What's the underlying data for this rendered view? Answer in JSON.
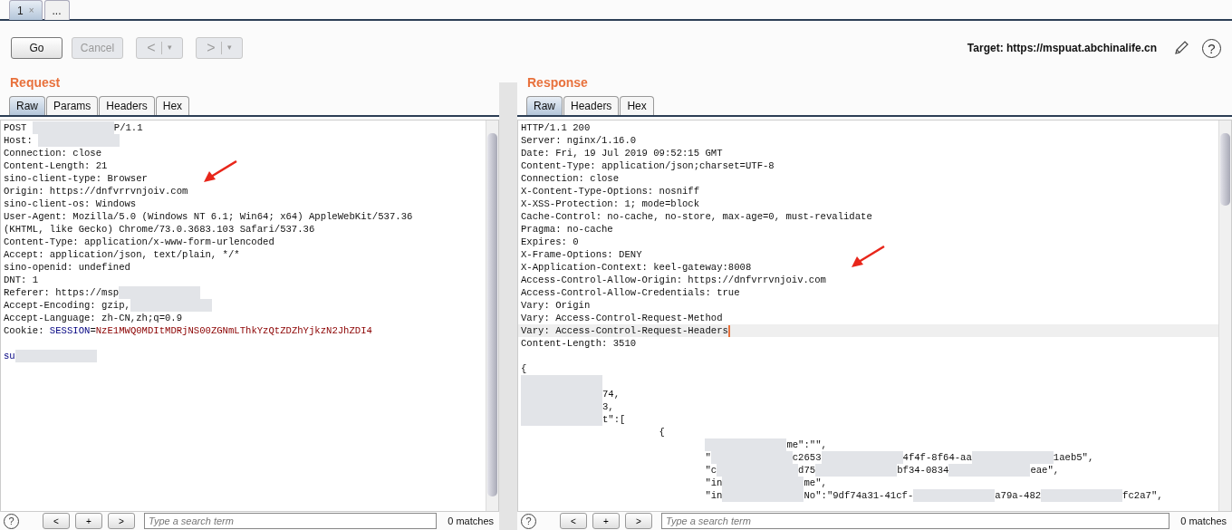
{
  "tabs": [
    {
      "label": "1",
      "close": "×",
      "selected": true
    },
    {
      "label": "...",
      "selected": false
    }
  ],
  "toolbar": {
    "buttons": [
      {
        "kind": "plain",
        "label": "Go",
        "disabled": false
      },
      {
        "kind": "plain",
        "label": "Cancel",
        "disabled": true
      },
      {
        "kind": "nav",
        "label": "<",
        "caret": "▾",
        "disabled": true
      },
      {
        "kind": "nav",
        "label": ">",
        "caret": "▾",
        "disabled": true
      }
    ],
    "target": "Target: https://mspuat.abchinalife.cn",
    "help": "?"
  },
  "panels": [
    {
      "title": "Request",
      "tabs": [
        {
          "label": "Raw",
          "selected": true
        },
        {
          "label": "Params",
          "selected": false
        },
        {
          "label": "Headers",
          "selected": false
        },
        {
          "label": "Hex",
          "selected": false
        }
      ],
      "lines": [
        {
          "segments": [
            {
              "kind": "text",
              "text": "POST "
            },
            {
              "kind": "redacted"
            },
            {
              "kind": "text",
              "text": "P/1.1"
            }
          ]
        },
        {
          "segments": [
            {
              "kind": "text",
              "text": "Host: "
            },
            {
              "kind": "redacted"
            }
          ]
        },
        {
          "segments": [
            {
              "kind": "text",
              "text": "Connection: close"
            }
          ]
        },
        {
          "segments": [
            {
              "kind": "text",
              "text": "Content-Length: 21"
            }
          ]
        },
        {
          "segments": [
            {
              "kind": "text",
              "text": "sino-client-type: Browser"
            }
          ]
        },
        {
          "segments": [
            {
              "kind": "text",
              "text": "Origin: https://dnfvrrvnjoiv.com"
            }
          ]
        },
        {
          "segments": [
            {
              "kind": "text",
              "text": "sino-client-os: Windows"
            }
          ]
        },
        {
          "segments": [
            {
              "kind": "text",
              "text": "User-Agent: Mozilla/5.0 (Windows NT 6.1; Win64; x64) AppleWebKit/537.36"
            }
          ]
        },
        {
          "segments": [
            {
              "kind": "text",
              "text": "(KHTML, like Gecko) Chrome/73.0.3683.103 Safari/537.36"
            }
          ]
        },
        {
          "segments": [
            {
              "kind": "text",
              "text": "Content-Type: application/x-www-form-urlencoded"
            }
          ]
        },
        {
          "segments": [
            {
              "kind": "text",
              "text": "Accept: application/json, text/plain, */*"
            }
          ]
        },
        {
          "segments": [
            {
              "kind": "text",
              "text": "sino-openid: undefined"
            }
          ]
        },
        {
          "segments": [
            {
              "kind": "text",
              "text": "DNT: 1"
            }
          ]
        },
        {
          "segments": [
            {
              "kind": "text",
              "text": "Referer: https://msp"
            },
            {
              "kind": "redacted"
            }
          ]
        },
        {
          "segments": [
            {
              "kind": "text",
              "text": "Accept-Encoding: gzip,"
            },
            {
              "kind": "redacted"
            }
          ]
        },
        {
          "segments": [
            {
              "kind": "text",
              "text": "Accept-Language: zh-CN,zh;q=0.9"
            }
          ]
        },
        {
          "segments": [
            {
              "kind": "text",
              "text": "Cookie: "
            },
            {
              "kind": "name",
              "text": "SESSION"
            },
            {
              "kind": "text",
              "text": "="
            },
            {
              "kind": "value",
              "text": "NzE1MWQ0MDItMDRjNS00ZGNmLThkYzQtZDZhYjkzN2JhZDI4"
            }
          ]
        },
        {
          "gap_before": true,
          "segments": [
            {
              "kind": "name",
              "text": "su"
            },
            {
              "kind": "redacted"
            }
          ]
        }
      ],
      "annotation_arrow": true,
      "search": {
        "help": "?",
        "placeholder": "Type a search term",
        "buttons": [
          "<",
          "+",
          ">"
        ],
        "matches": "0 matches"
      }
    },
    {
      "title": "Response",
      "tabs": [
        {
          "label": "Raw",
          "selected": true
        },
        {
          "label": "Headers",
          "selected": false
        },
        {
          "label": "Hex",
          "selected": false
        }
      ],
      "lines": [
        {
          "segments": [
            {
              "kind": "text",
              "text": "HTTP/1.1 200"
            }
          ]
        },
        {
          "segments": [
            {
              "kind": "text",
              "text": "Server: nginx/1.16.0"
            }
          ]
        },
        {
          "segments": [
            {
              "kind": "text",
              "text": "Date: Fri, 19 Jul 2019 09:52:15 GMT"
            }
          ]
        },
        {
          "segments": [
            {
              "kind": "text",
              "text": "Content-Type: application/json;charset=UTF-8"
            }
          ]
        },
        {
          "segments": [
            {
              "kind": "text",
              "text": "Connection: close"
            }
          ]
        },
        {
          "segments": [
            {
              "kind": "text",
              "text": "X-Content-Type-Options: nosniff"
            }
          ]
        },
        {
          "segments": [
            {
              "kind": "text",
              "text": "X-XSS-Protection: 1; mode=block"
            }
          ]
        },
        {
          "segments": [
            {
              "kind": "text",
              "text": "Cache-Control: no-cache, no-store, max-age=0, must-revalidate"
            }
          ]
        },
        {
          "segments": [
            {
              "kind": "text",
              "text": "Pragma: no-cache"
            }
          ]
        },
        {
          "segments": [
            {
              "kind": "text",
              "text": "Expires: 0"
            }
          ]
        },
        {
          "segments": [
            {
              "kind": "text",
              "text": "X-Frame-Options: DENY"
            }
          ]
        },
        {
          "segments": [
            {
              "kind": "text",
              "text": "X-Application-Context: keel-gateway:8008"
            }
          ]
        },
        {
          "segments": [
            {
              "kind": "text",
              "text": "Access-Control-Allow-Origin: https://dnfvrrvnjoiv.com"
            }
          ]
        },
        {
          "segments": [
            {
              "kind": "text",
              "text": "Access-Control-Allow-Credentials: true"
            }
          ]
        },
        {
          "segments": [
            {
              "kind": "text",
              "text": "Vary: Origin"
            }
          ]
        },
        {
          "segments": [
            {
              "kind": "text",
              "text": "Vary: Access-Control-Request-Method"
            }
          ]
        },
        {
          "segments": [
            {
              "kind": "text",
              "text": "Vary: Access-Control-Request-Headers"
            }
          ],
          "highlighted": true
        },
        {
          "segments": [
            {
              "kind": "text",
              "text": "Content-Length: 3510"
            }
          ]
        },
        {
          "gap_before": true,
          "segments": [
            {
              "kind": "text",
              "text": "{"
            }
          ]
        },
        {
          "segments": [
            {
              "kind": "redacted"
            }
          ]
        },
        {
          "segments": [
            {
              "kind": "redacted"
            },
            {
              "kind": "text",
              "text": "74,"
            }
          ]
        },
        {
          "segments": [
            {
              "kind": "redacted"
            },
            {
              "kind": "text",
              "text": "3,"
            }
          ]
        },
        {
          "segments": [
            {
              "kind": "redacted"
            },
            {
              "kind": "text",
              "text": "t\":["
            }
          ]
        },
        {
          "segments": [
            {
              "kind": "indent"
            },
            {
              "kind": "indent"
            },
            {
              "kind": "indent"
            },
            {
              "kind": "text",
              "text": "{"
            }
          ]
        },
        {
          "segments": [
            {
              "kind": "indent"
            },
            {
              "kind": "indent"
            },
            {
              "kind": "indent"
            },
            {
              "kind": "indent"
            },
            {
              "kind": "redacted"
            },
            {
              "kind": "text",
              "text": "me\":\"\","
            }
          ]
        },
        {
          "segments": [
            {
              "kind": "indent"
            },
            {
              "kind": "indent"
            },
            {
              "kind": "indent"
            },
            {
              "kind": "indent"
            },
            {
              "kind": "text",
              "text": "\""
            },
            {
              "kind": "redacted"
            },
            {
              "kind": "text",
              "text": "c2653"
            },
            {
              "kind": "redacted"
            },
            {
              "kind": "text",
              "text": "4f4f-8f64-aa"
            },
            {
              "kind": "redacted"
            },
            {
              "kind": "text",
              "text": "1aeb5\","
            }
          ]
        },
        {
          "segments": [
            {
              "kind": "indent"
            },
            {
              "kind": "indent"
            },
            {
              "kind": "indent"
            },
            {
              "kind": "indent"
            },
            {
              "kind": "text",
              "text": "\"c"
            },
            {
              "kind": "redacted"
            },
            {
              "kind": "text",
              "text": "d75"
            },
            {
              "kind": "redacted"
            },
            {
              "kind": "text",
              "text": "bf34-0834"
            },
            {
              "kind": "redacted"
            },
            {
              "kind": "text",
              "text": "eae\","
            }
          ]
        },
        {
          "segments": [
            {
              "kind": "indent"
            },
            {
              "kind": "indent"
            },
            {
              "kind": "indent"
            },
            {
              "kind": "indent"
            },
            {
              "kind": "text",
              "text": "\"in"
            },
            {
              "kind": "redacted"
            },
            {
              "kind": "text",
              "text": "me\","
            }
          ]
        },
        {
          "segments": [
            {
              "kind": "indent"
            },
            {
              "kind": "indent"
            },
            {
              "kind": "indent"
            },
            {
              "kind": "indent"
            },
            {
              "kind": "text",
              "text": "\"in"
            },
            {
              "kind": "redacted"
            },
            {
              "kind": "text",
              "text": "No\":\"9df74a31-41cf-"
            },
            {
              "kind": "redacted"
            },
            {
              "kind": "text",
              "text": "a79a-482"
            },
            {
              "kind": "redacted"
            },
            {
              "kind": "text",
              "text": "fc2a7\","
            }
          ]
        }
      ],
      "annotation_arrow": true,
      "search": {
        "help": "?",
        "placeholder": "Type a search term",
        "buttons": [
          "<",
          "+",
          ">"
        ],
        "matches": "0 matches"
      }
    }
  ]
}
